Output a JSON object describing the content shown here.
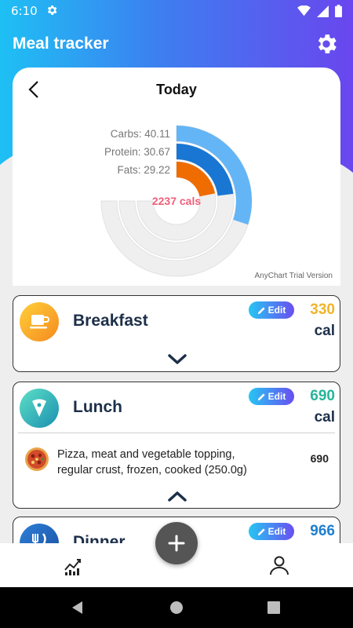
{
  "status_bar": {
    "time": "6:10"
  },
  "header": {
    "title": "Meal tracker"
  },
  "chart_card": {
    "title": "Today",
    "watermark": "AnyChart Trial Version"
  },
  "chart_data": {
    "type": "radial-bar",
    "center_label": "2237 cals",
    "series": [
      {
        "label": "Carbs: 40.11",
        "name": "Carbs",
        "value": 40.11,
        "color": "#64b5f6"
      },
      {
        "label": "Protein: 30.67",
        "name": "Protein",
        "value": 30.67,
        "color": "#1976d2"
      },
      {
        "label": "Fats: 29.22",
        "name": "Fats",
        "value": 29.22,
        "color": "#ef6c00"
      }
    ],
    "max": 100,
    "track_color": "#efefef"
  },
  "meals": {
    "breakfast": {
      "name": "Breakfast",
      "edit_label": "Edit",
      "calories": "330",
      "unit": "cal",
      "color": "#f0b429",
      "icon": "coffee-cup-icon"
    },
    "lunch": {
      "name": "Lunch",
      "edit_label": "Edit",
      "calories": "690",
      "unit": "cal",
      "color": "#26b49a",
      "icon": "pizza-slice-icon",
      "items": [
        {
          "name": "Pizza, meat and vegetable topping, regular crust, frozen, cooked (250.0g)",
          "calories": "690"
        }
      ]
    },
    "dinner": {
      "name": "Dinner",
      "edit_label": "Edit",
      "calories": "966",
      "color": "#1f7fcf",
      "icon": "fork-knife-icon"
    }
  },
  "bottom_nav": {
    "stats_icon": "stats-chart-icon",
    "profile_icon": "profile-icon",
    "add_icon": "plus-icon"
  }
}
